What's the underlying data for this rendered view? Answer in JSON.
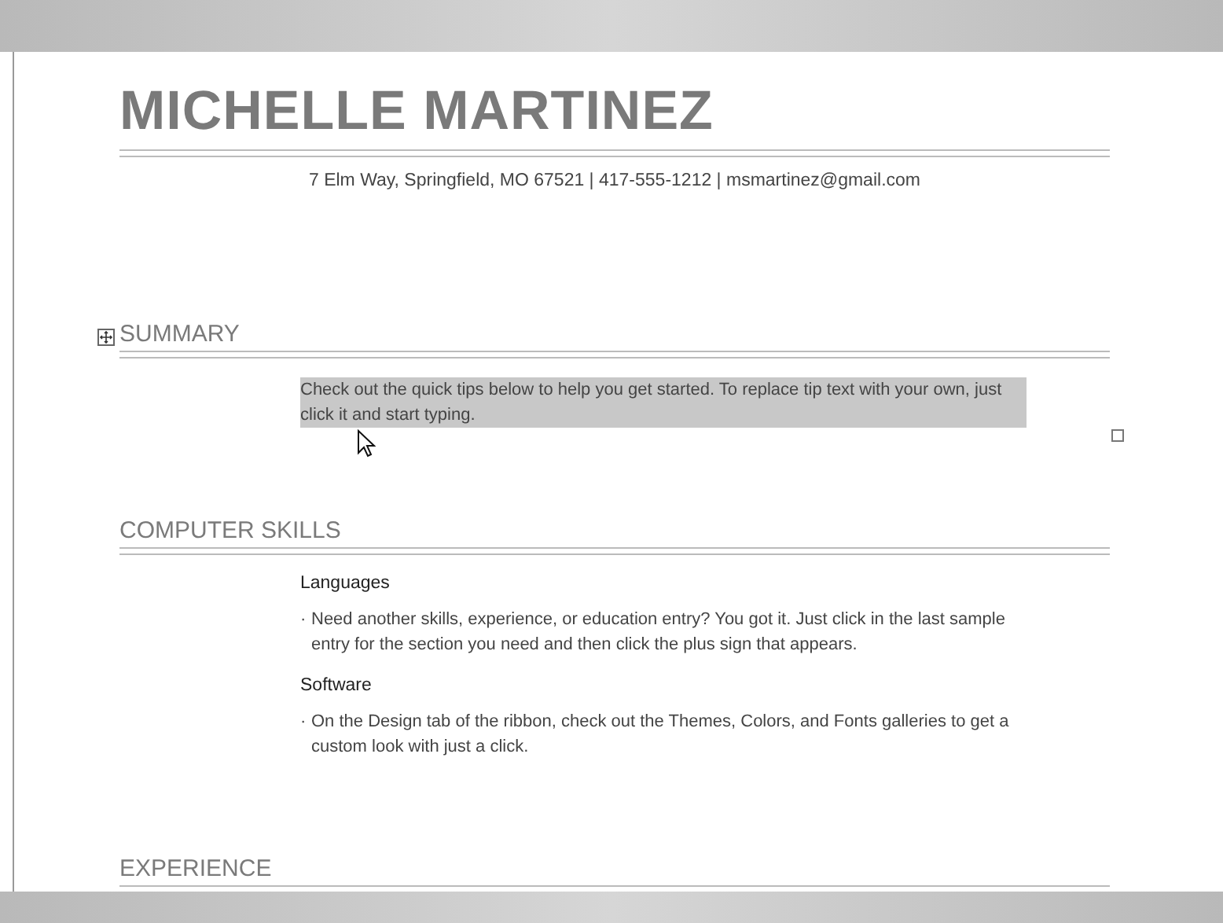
{
  "document": {
    "name": "MICHELLE MARTINEZ",
    "contact": "7 Elm Way, Springfield, MO 67521 | 417-555-1212 | msmartinez@gmail.com",
    "sections": [
      {
        "heading": "SUMMARY",
        "kind": "paragraph",
        "text": "Check out the quick tips below to help you get started. To replace tip text with your own, just click it and start typing.",
        "selected": true
      },
      {
        "heading": "COMPUTER SKILLS",
        "kind": "entries",
        "entries": [
          {
            "title": "Languages",
            "bullets": [
              {
                "marker": "·",
                "text": "Need another skills, experience, or education entry? You got it. Just click in the last sample entry for the section you need and then click the plus sign that appears."
              }
            ]
          },
          {
            "title": "Software",
            "bullets": [
              {
                "marker": "·",
                "text": "On the Design tab of the ribbon, check out the Themes, Colors, and Fonts galleries to get a custom look with just a click."
              }
            ]
          }
        ]
      },
      {
        "heading": "EXPERIENCE",
        "kind": "empty"
      }
    ]
  }
}
